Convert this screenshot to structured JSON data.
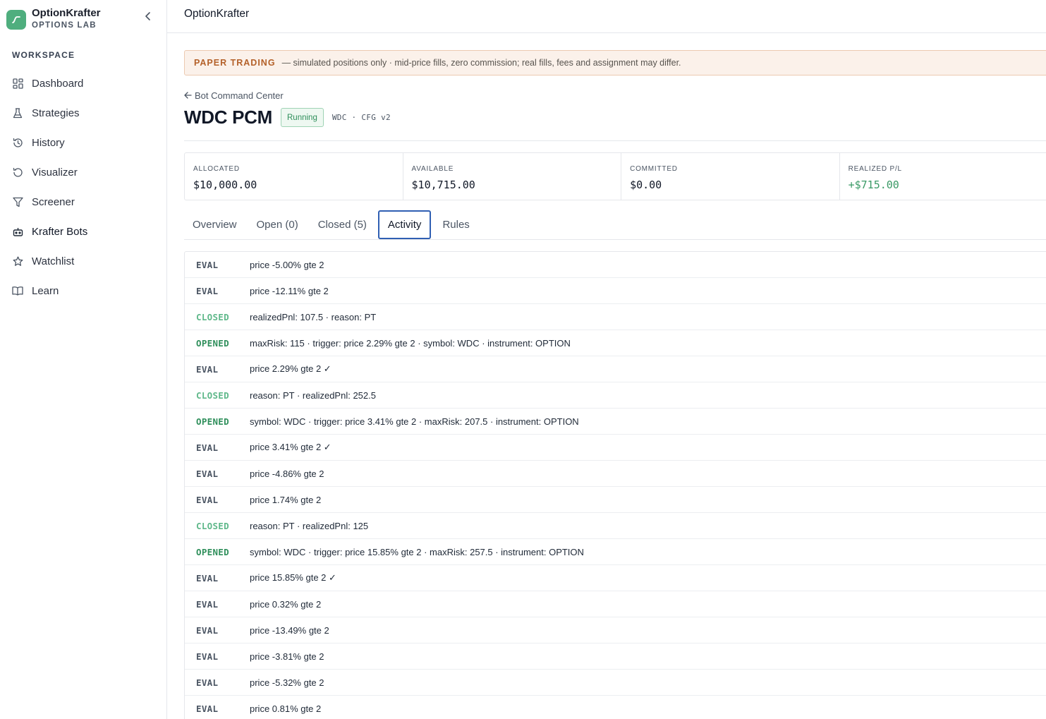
{
  "brand": {
    "name": "OptionKrafter",
    "subtitle": "OPTIONS LAB"
  },
  "sidebar": {
    "section_label": "WORKSPACE",
    "items": [
      {
        "label": "Dashboard",
        "icon": "grid-icon"
      },
      {
        "label": "Strategies",
        "icon": "flask-icon"
      },
      {
        "label": "History",
        "icon": "history-icon"
      },
      {
        "label": "Visualizer",
        "icon": "refresh-icon"
      },
      {
        "label": "Screener",
        "icon": "filter-icon"
      },
      {
        "label": "Krafter Bots",
        "icon": "bot-icon"
      },
      {
        "label": "Watchlist",
        "icon": "star-icon"
      },
      {
        "label": "Learn",
        "icon": "book-icon"
      }
    ],
    "active_item": "Krafter Bots"
  },
  "topbar": {
    "title": "OptionKrafter"
  },
  "banner": {
    "tag": "PAPER TRADING",
    "text": "— simulated positions only · mid-price fills, zero commission; real fills, fees and assignment may differ."
  },
  "back_link": "Bot Command Center",
  "bot": {
    "title": "WDC PCM",
    "status": "Running",
    "meta": "WDC · CFG v2"
  },
  "stats": [
    {
      "label": "ALLOCATED",
      "value": "$10,000.00"
    },
    {
      "label": "AVAILABLE",
      "value": "$10,715.00"
    },
    {
      "label": "COMMITTED",
      "value": "$0.00"
    },
    {
      "label": "REALIZED P/L",
      "value": "+$715.00"
    }
  ],
  "tabs": [
    "Overview",
    "Open (0)",
    "Closed (5)",
    "Activity",
    "Rules"
  ],
  "active_tab": "Activity",
  "activity": [
    {
      "kind": "EVAL",
      "detail": "price -5.00% gte 2"
    },
    {
      "kind": "EVAL",
      "detail": "price -12.11% gte 2"
    },
    {
      "kind": "CLOSED",
      "detail": "realizedPnl: 107.5 · reason: PT"
    },
    {
      "kind": "OPENED",
      "detail": "maxRisk: 115 · trigger: price 2.29% gte 2 · symbol: WDC · instrument: OPTION"
    },
    {
      "kind": "EVAL",
      "detail": "price 2.29% gte 2 ✓"
    },
    {
      "kind": "CLOSED",
      "detail": "reason: PT · realizedPnl: 252.5"
    },
    {
      "kind": "OPENED",
      "detail": "symbol: WDC · trigger: price 3.41% gte 2 · maxRisk: 207.5 · instrument: OPTION"
    },
    {
      "kind": "EVAL",
      "detail": "price 3.41% gte 2 ✓"
    },
    {
      "kind": "EVAL",
      "detail": "price -4.86% gte 2"
    },
    {
      "kind": "EVAL",
      "detail": "price 1.74% gte 2"
    },
    {
      "kind": "CLOSED",
      "detail": "reason: PT · realizedPnl: 125"
    },
    {
      "kind": "OPENED",
      "detail": "symbol: WDC · trigger: price 15.85% gte 2 · maxRisk: 257.5 · instrument: OPTION"
    },
    {
      "kind": "EVAL",
      "detail": "price 15.85% gte 2 ✓"
    },
    {
      "kind": "EVAL",
      "detail": "price 0.32% gte 2"
    },
    {
      "kind": "EVAL",
      "detail": "price -13.49% gte 2"
    },
    {
      "kind": "EVAL",
      "detail": "price -3.81% gte 2"
    },
    {
      "kind": "EVAL",
      "detail": "price -5.32% gte 2"
    },
    {
      "kind": "EVAL",
      "detail": "price 0.81% gte 2"
    }
  ],
  "colors": {
    "brand_green": "#4fae7e",
    "banner_bg": "#fbf1ea",
    "banner_tag": "#b4612a",
    "opened": "#2f8f5b",
    "closed": "#5fb88a",
    "positive": "#3a9a66",
    "active_tab_border": "#2f5fb3"
  }
}
